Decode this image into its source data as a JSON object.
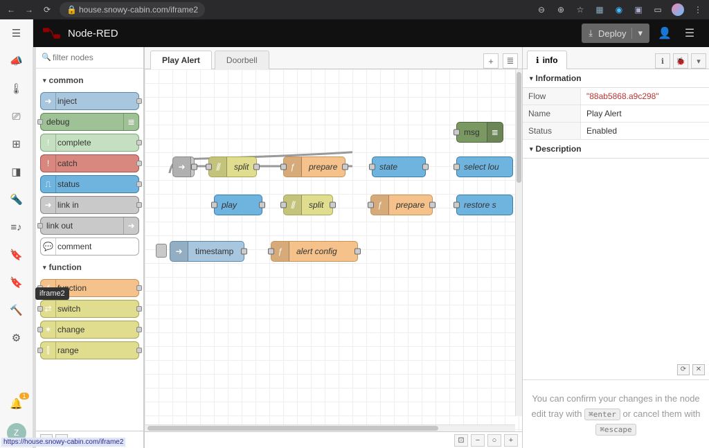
{
  "browser": {
    "url": "house.snowy-cabin.com/iframe2",
    "status_link": "https://house.snowy-cabin.com/iframe2"
  },
  "rail": {
    "tooltip": "iframe2",
    "avatar": "Z",
    "badge": "1"
  },
  "header": {
    "title": "Node-RED",
    "deploy": "Deploy"
  },
  "palette": {
    "filter_placeholder": "filter nodes",
    "cat_common": "common",
    "cat_function": "function",
    "nodes": {
      "inject": "inject",
      "debug": "debug",
      "complete": "complete",
      "catch": "catch",
      "status": "status",
      "link_in": "link in",
      "link_out": "link out",
      "comment": "comment",
      "function": "function",
      "switch": "switch",
      "change": "change",
      "range": "range"
    }
  },
  "tabs": {
    "play_alert": "Play Alert",
    "doorbell": "Doorbell"
  },
  "canvas": {
    "msg": "msg",
    "split": "split",
    "prepare": "prepare",
    "state": "state",
    "select_lou": "select lou",
    "play": "play",
    "split2": "split",
    "prepare2": "prepare",
    "restore": "restore s",
    "timestamp": "timestamp",
    "alert_config": "alert config"
  },
  "sidebar": {
    "tab_info": "info",
    "sec_information": "Information",
    "sec_description": "Description",
    "flow_k": "Flow",
    "flow_v": "\"88ab5868.a9c298\"",
    "name_k": "Name",
    "name_v": "Play Alert",
    "status_k": "Status",
    "status_v": "Enabled",
    "tip_1": "You can confirm your changes in the node edit tray with ",
    "tip_kbd1": "⌘enter",
    "tip_2": " or cancel them with ",
    "tip_kbd2": "⌘escape"
  }
}
